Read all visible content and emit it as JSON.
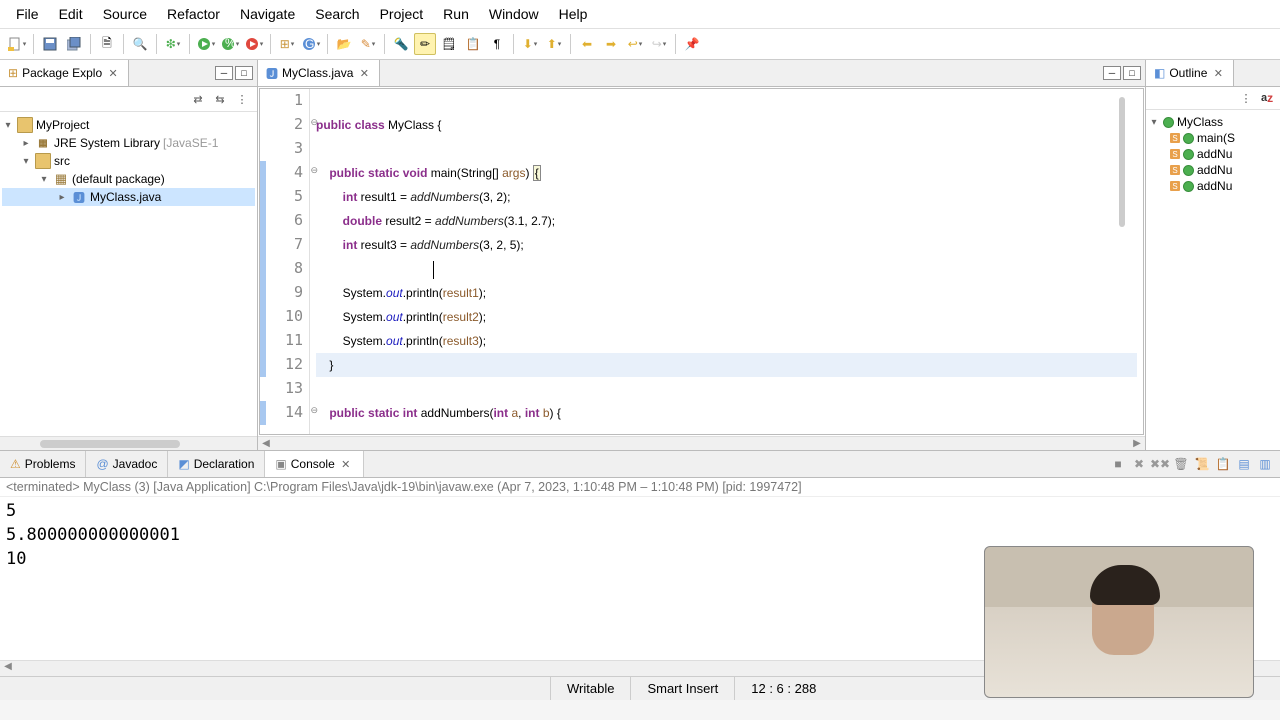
{
  "menu": [
    "File",
    "Edit",
    "Source",
    "Refactor",
    "Navigate",
    "Search",
    "Project",
    "Run",
    "Window",
    "Help"
  ],
  "left_pane": {
    "title": "Package Explo",
    "project": "MyProject",
    "jre": "JRE System Library",
    "jre_suffix": "[JavaSE-1",
    "src": "src",
    "pkg": "(default package)",
    "file": "MyClass.java"
  },
  "editor": {
    "tab": "MyClass.java",
    "lines": [
      {
        "n": 1,
        "html": ""
      },
      {
        "n": 2,
        "html": "<span class='kw'>public</span> <span class='kw'>class</span> MyClass {"
      },
      {
        "n": 3,
        "html": ""
      },
      {
        "n": 4,
        "html": "    <span class='kw'>public</span> <span class='kw'>static</span> <span class='kw'>void</span> main(String[] <span class='param'>args</span>) <span class='match'>{</span>"
      },
      {
        "n": 5,
        "html": "        <span class='kw'>int</span> result1 = <span class='mtd'>addNumbers</span>(3, 2);"
      },
      {
        "n": 6,
        "html": "        <span class='kw'>double</span> result2 = <span class='mtd'>addNumbers</span>(3.1, 2.7);"
      },
      {
        "n": 7,
        "html": "        <span class='kw'>int</span> result3 = <span class='mtd'>addNumbers</span>(3, 2, 5);"
      },
      {
        "n": 8,
        "html": ""
      },
      {
        "n": 9,
        "html": "        System.<span class='fld'>out</span>.println(<span class='param'>result1</span>);"
      },
      {
        "n": 10,
        "html": "        System.<span class='fld'>out</span>.println(<span class='param'>result2</span>);"
      },
      {
        "n": 11,
        "html": "        System.<span class='fld'>out</span>.println(<span class='param'>result3</span>);"
      },
      {
        "n": 12,
        "html": "    }",
        "hl": true
      },
      {
        "n": 13,
        "html": ""
      },
      {
        "n": 14,
        "html": "    <span class='kw'>public</span> <span class='kw'>static</span> <span class='kw'>int</span> addNumbers(<span class='kw'>int</span> <span class='param'>a</span>, <span class='kw'>int</span> <span class='param'>b</span>) {"
      }
    ]
  },
  "outline": {
    "title": "Outline",
    "class": "MyClass",
    "members": [
      "main(S",
      "addNu",
      "addNu",
      "addNu"
    ]
  },
  "bottom": {
    "tabs": [
      "Problems",
      "Javadoc",
      "Declaration",
      "Console"
    ],
    "active": 3,
    "status": "<terminated> MyClass (3) [Java Application] C:\\Program Files\\Java\\jdk-19\\bin\\javaw.exe (Apr 7, 2023, 1:10:48 PM – 1:10:48 PM) [pid: 1997472]",
    "output": "5\n5.800000000000001\n10"
  },
  "status": {
    "writable": "Writable",
    "insert": "Smart Insert",
    "pos": "12 : 6 : 288"
  }
}
